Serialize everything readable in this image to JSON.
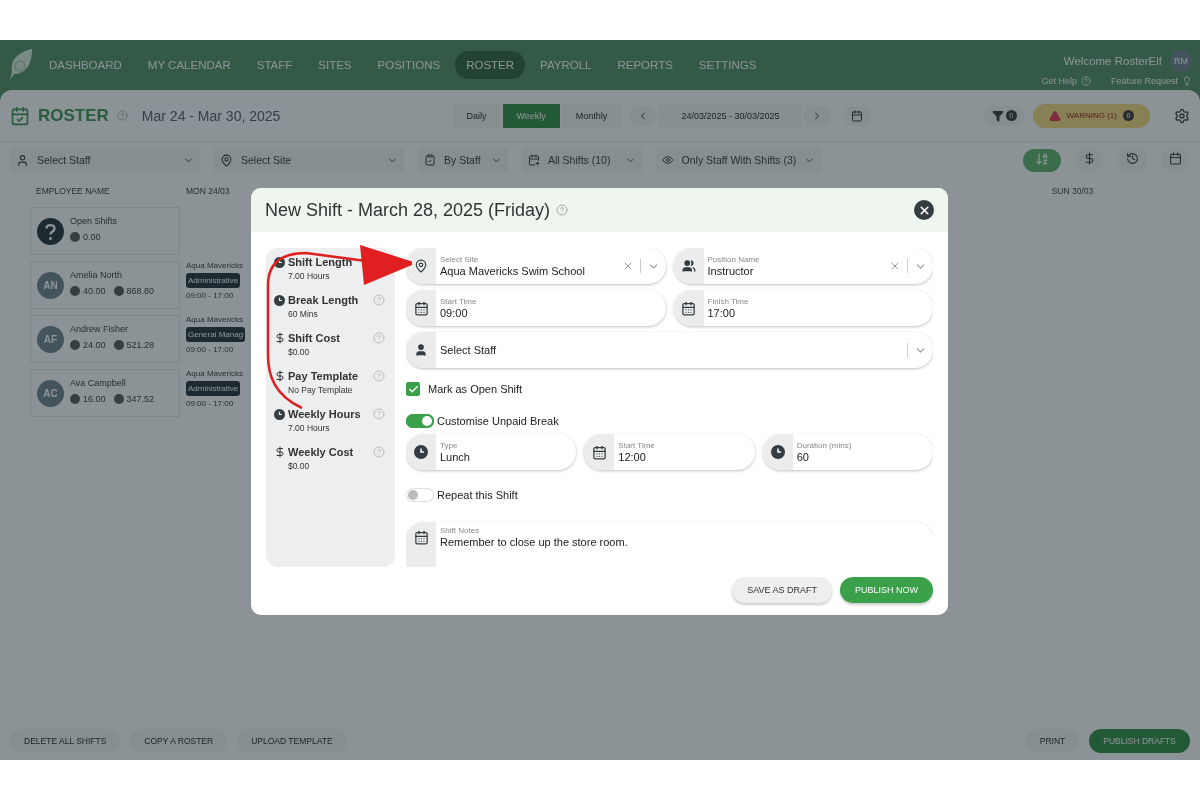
{
  "nav": {
    "items": [
      {
        "label": "DASHBOARD",
        "selected": false
      },
      {
        "label": "MY CALENDAR",
        "selected": false
      },
      {
        "label": "STAFF",
        "selected": false
      },
      {
        "label": "SITES",
        "selected": false
      },
      {
        "label": "POSITIONS",
        "selected": false
      },
      {
        "label": "ROSTER",
        "selected": true
      },
      {
        "label": "PAYROLL",
        "selected": false
      },
      {
        "label": "REPORTS",
        "selected": false
      },
      {
        "label": "SETTINGS",
        "selected": false
      }
    ],
    "welcome": "Welcome RosterElf",
    "avatar": "RM",
    "links": [
      "Get Help",
      "Feature Request"
    ]
  },
  "toolbar": {
    "title": "ROSTER",
    "date_range": "Mar 24 - Mar 30, 2025",
    "views": [
      {
        "label": "Daily",
        "selected": false
      },
      {
        "label": "Weekly",
        "selected": true
      },
      {
        "label": "Monthly",
        "selected": false
      }
    ],
    "date_field": "24/03/2025 - 30/03/2025",
    "filter_count": "0",
    "warning": {
      "label": "WARNING (1)",
      "count": "0"
    }
  },
  "filters": {
    "staff_placeholder": "Select Staff",
    "site_placeholder": "Select Site",
    "group": "By Staff",
    "shifts": "All Shifts (10)",
    "visibility": "Only Staff With Shifts (3)"
  },
  "table": {
    "columns": [
      "EMPLOYEE NAME",
      "MON 24/03",
      "SUN 30/03"
    ],
    "rows": [
      {
        "kind": "open",
        "name": "Open Shifts",
        "hours": "0.00"
      },
      {
        "kind": "staff",
        "name": "Amelia North",
        "initials": "AN",
        "hours": "40.00",
        "cost": "868.80",
        "shift": {
          "site": "Aqua Mavericks",
          "position": "Administrative",
          "time": "09:00 - 17:00"
        }
      },
      {
        "kind": "staff",
        "name": "Andrew Fisher",
        "initials": "AF",
        "hours": "24.00",
        "cost": "521.28",
        "shift": {
          "site": "Aqua Mavericks",
          "position": "General Manag",
          "time": "09:00 - 17:00"
        }
      },
      {
        "kind": "staff",
        "name": "Ava Campbell",
        "initials": "AC",
        "hours": "16.00",
        "cost": "347.52",
        "shift": {
          "site": "Aqua Mavericks",
          "position": "Administrative",
          "time": "09:00 - 17:00"
        }
      }
    ]
  },
  "bottom_bar": {
    "left": [
      "DELETE ALL SHIFTS",
      "COPY A ROSTER",
      "UPLOAD TEMPLATE"
    ],
    "print": "PRINT",
    "publish": "PUBLISH DRAFTS"
  },
  "modal": {
    "title": "New Shift - March 28, 2025 (Friday)",
    "summary": [
      {
        "kind": "clock",
        "label": "Shift Length",
        "value": "7.00 Hours",
        "help": false
      },
      {
        "kind": "clock",
        "label": "Break Length",
        "value": "60 Mins",
        "help": true
      },
      {
        "kind": "dollar",
        "label": "Shift Cost",
        "value": "$0.00",
        "help": true
      },
      {
        "kind": "dollar",
        "label": "Pay Template",
        "value": "No Pay Template",
        "help": true
      },
      {
        "kind": "clock",
        "label": "Weekly Hours",
        "value": "7.00 Hours",
        "help": true
      },
      {
        "kind": "dollar",
        "label": "Weekly Cost",
        "value": "$0.00",
        "help": true
      }
    ],
    "site": {
      "label": "Select Site",
      "value": "Aqua Mavericks Swim School"
    },
    "position": {
      "label": "Position Name",
      "value": "Instructor"
    },
    "start_time": {
      "label": "Start Time",
      "value": "09:00"
    },
    "finish_time": {
      "label": "Finish Time",
      "value": "17:00"
    },
    "staff": {
      "placeholder": "Select Staff"
    },
    "open_shift": {
      "label": "Mark as Open Shift",
      "checked": true
    },
    "unpaid_break": {
      "label": "Customise Unpaid Break",
      "on": true
    },
    "break_fields": [
      {
        "kind": "clock",
        "label": "Type",
        "value": "Lunch"
      },
      {
        "kind": "calendar",
        "label": "Start Time",
        "value": "12:00"
      },
      {
        "kind": "clock",
        "label": "Duration (mins)",
        "value": "60"
      }
    ],
    "repeat": {
      "label": "Repeat this Shift",
      "on": false
    },
    "notes": {
      "label": "Shift Notes",
      "value": "Remember to close up the store room."
    },
    "save_draft": "SAVE AS DRAFT",
    "publish": "PUBLISH NOW"
  }
}
